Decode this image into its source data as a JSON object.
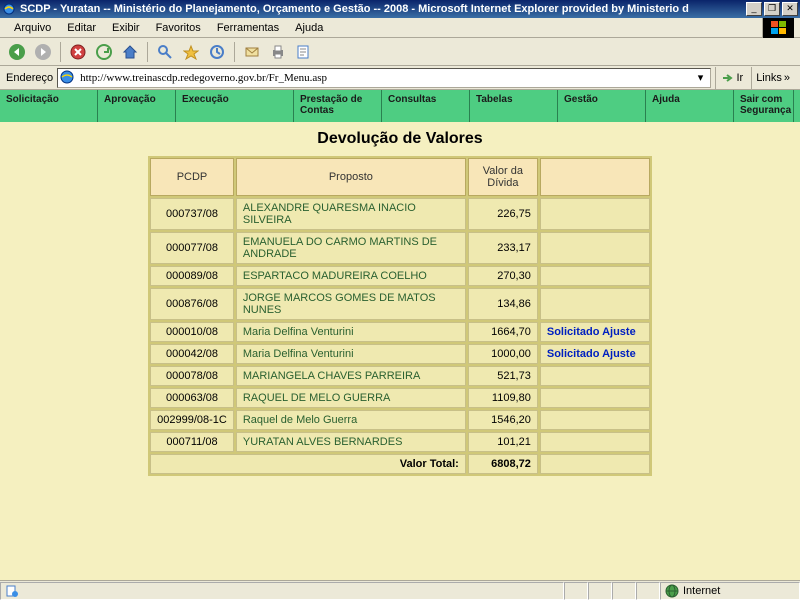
{
  "window": {
    "title": "SCDP - Yuratan -- Ministério do Planejamento, Orçamento e Gestão -- 2008 - Microsoft Internet Explorer provided by Ministerio d"
  },
  "menubar": [
    "Arquivo",
    "Editar",
    "Exibir",
    "Favoritos",
    "Ferramentas",
    "Ajuda"
  ],
  "addressbar": {
    "label": "Endereço",
    "url": "http://www.treinascdp.redegoverno.gov.br/Fr_Menu.asp",
    "go": "Ir",
    "links": "Links"
  },
  "nav": [
    "Solicitação",
    "Aprovação",
    "Execução",
    "Prestação de Contas",
    "Consultas",
    "Tabelas",
    "Gestão",
    "Ajuda",
    "Sair com Segurança"
  ],
  "page": {
    "title": "Devolução de Valores",
    "headers": {
      "pcdp": "PCDP",
      "proposto": "Proposto",
      "valor": "Valor da Dívida"
    },
    "rows": [
      {
        "pcdp": "000737/08",
        "proposto": "ALEXANDRE QUARESMA INACIO SILVEIRA",
        "valor": "226,75",
        "status": ""
      },
      {
        "pcdp": "000077/08",
        "proposto": "EMANUELA DO CARMO MARTINS DE ANDRADE",
        "valor": "233,17",
        "status": ""
      },
      {
        "pcdp": "000089/08",
        "proposto": "ESPARTACO MADUREIRA COELHO",
        "valor": "270,30",
        "status": ""
      },
      {
        "pcdp": "000876/08",
        "proposto": "JORGE MARCOS GOMES DE MATOS NUNES",
        "valor": "134,86",
        "status": ""
      },
      {
        "pcdp": "000010/08",
        "proposto": "Maria Delfina Venturini",
        "valor": "1664,70",
        "status": "Solicitado Ajuste"
      },
      {
        "pcdp": "000042/08",
        "proposto": "Maria Delfina Venturini",
        "valor": "1000,00",
        "status": "Solicitado Ajuste"
      },
      {
        "pcdp": "000078/08",
        "proposto": "MARIANGELA CHAVES PARREIRA",
        "valor": "521,73",
        "status": ""
      },
      {
        "pcdp": "000063/08",
        "proposto": "RAQUEL DE MELO GUERRA",
        "valor": "1109,80",
        "status": ""
      },
      {
        "pcdp": "002999/08-1C",
        "proposto": "Raquel de Melo Guerra",
        "valor": "1546,20",
        "status": ""
      },
      {
        "pcdp": "000711/08",
        "proposto": "YURATAN ALVES BERNARDES",
        "valor": "101,21",
        "status": ""
      }
    ],
    "total_label": "Valor Total:",
    "total_value": "6808,72"
  },
  "statusbar": {
    "zone": "Internet"
  }
}
